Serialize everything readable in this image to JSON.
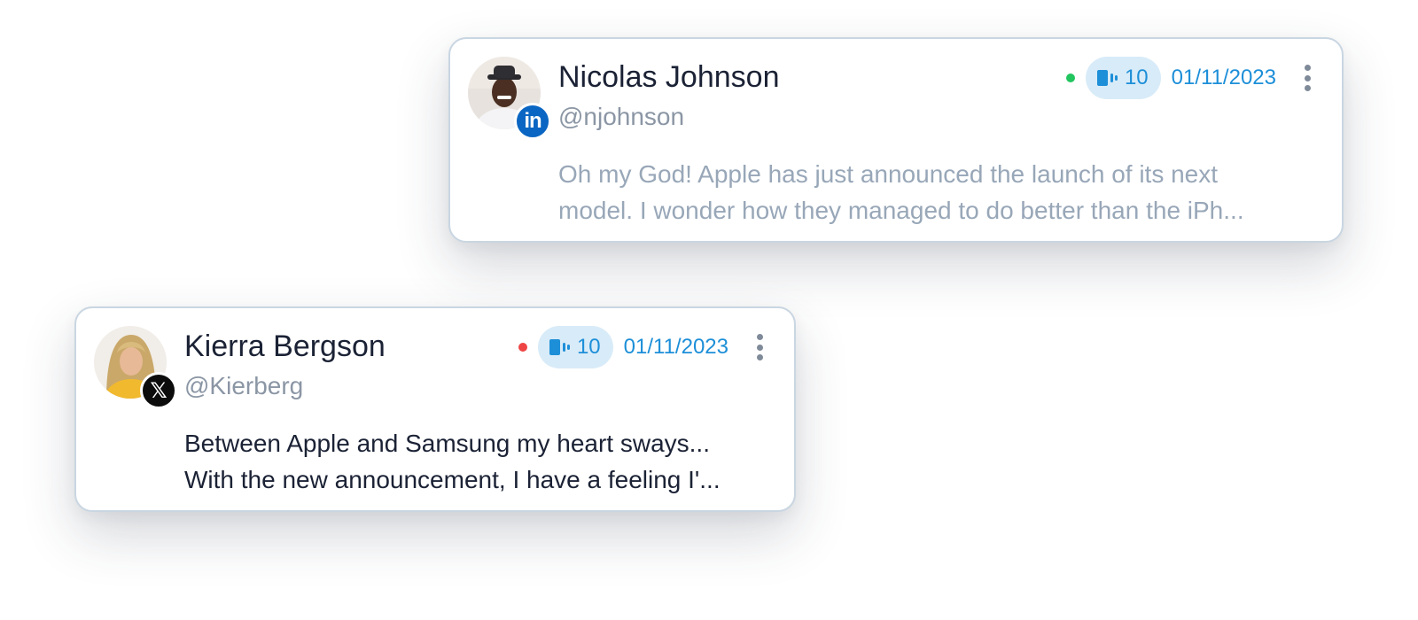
{
  "posts": [
    {
      "author_name": "Nicolas Johnson",
      "handle": "@njohnson",
      "network": "linkedin",
      "network_icon": "linkedin-icon",
      "network_badge_text": "in",
      "status_color": "#22c55e",
      "count": "10",
      "date": "01/11/2023",
      "message_lines": [
        "Oh my God! Apple has just announced the launch of its next",
        "model. I wonder how they managed to do better than the iPh..."
      ]
    },
    {
      "author_name": "Kierra Bergson",
      "handle": "@Kierberg",
      "network": "x",
      "network_icon": "x-icon",
      "network_badge_text": "𝕏",
      "status_color": "#ef4444",
      "count": "10",
      "date": "01/11/2023",
      "message_lines": [
        "Between Apple and Samsung my heart sways...",
        "With the new announcement, I have a feeling I'..."
      ]
    }
  ],
  "colors": {
    "accent": "#1d8fd8",
    "pill_background": "#d8ebf8",
    "linkedin": "#0a66c2",
    "x": "#0c0c0c"
  }
}
